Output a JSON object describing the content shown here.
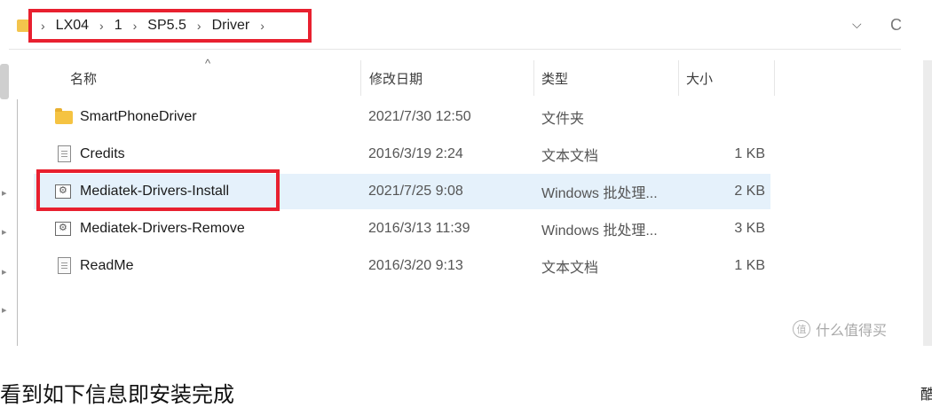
{
  "breadcrumb": {
    "items": [
      "LX04",
      "1",
      "SP5.5",
      "Driver"
    ],
    "separator": "›",
    "trailing_separator": "›",
    "highlight_color": "#e8202f"
  },
  "address_bar": {
    "dropdown_icon": "chevron-down-icon",
    "refresh_icon": "refresh-icon",
    "dropdown_glyph": "⌵",
    "refresh_glyph": "C"
  },
  "columns": {
    "name": "名称",
    "modified": "修改日期",
    "type": "类型",
    "size": "大小",
    "sort_glyph": "^"
  },
  "files": [
    {
      "name": "SmartPhoneDriver",
      "modified": "2021/7/30 12:50",
      "type": "文件夹",
      "size": "",
      "icon": "folder-icon"
    },
    {
      "name": "Credits",
      "modified": "2016/3/19 2:24",
      "type": "文本文档",
      "size": "1 KB",
      "icon": "text-file-icon"
    },
    {
      "name": "Mediatek-Drivers-Install",
      "modified": "2021/7/25 9:08",
      "type": "Windows 批处理...",
      "size": "2 KB",
      "icon": "batch-file-icon",
      "selected": true
    },
    {
      "name": "Mediatek-Drivers-Remove",
      "modified": "2016/3/13 11:39",
      "type": "Windows 批处理...",
      "size": "3 KB",
      "icon": "batch-file-icon"
    },
    {
      "name": "ReadMe",
      "modified": "2016/3/20 9:13",
      "type": "文本文档",
      "size": "1 KB",
      "icon": "text-file-icon"
    }
  ],
  "watermark": {
    "text": "什么值得买",
    "badge": "值"
  },
  "caption": {
    "text": "看到如下信息即安装完成",
    "right_mark": "酷"
  },
  "colors": {
    "selection": "#e5f1fb",
    "highlight_border": "#e8202f",
    "folder": "#f5c342"
  }
}
